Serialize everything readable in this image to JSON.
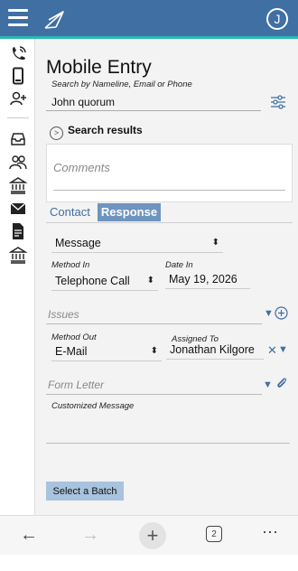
{
  "header": {
    "avatar_initial": "J"
  },
  "form": {
    "title": "Mobile Entry",
    "search_label": "Search by Nameline, Email or Phone",
    "search_value": "John quorum",
    "results_label": "Search results",
    "comments_placeholder": "Comments",
    "tabs": [
      {
        "label": "Contact"
      },
      {
        "label": "Response",
        "active": true
      }
    ],
    "message_type": "Message",
    "method_in_label": "Method In",
    "method_in_value": "Telephone Call",
    "date_in_label": "Date In",
    "date_in_value": "May 19, 2026",
    "issues_placeholder": "Issues",
    "method_out_label": "Method Out",
    "method_out_value": "E-Mail",
    "assigned_to_label": "Assigned To",
    "assigned_to_value": "Jonathan Kilgore",
    "form_letter_placeholder": "Form Letter",
    "customized_message_label": "Customized Message",
    "select_batch_label": "Select a Batch"
  },
  "browser": {
    "tab_count": "2"
  },
  "colors": {
    "brand_blue": "#3f6fa3",
    "accent_teal": "#2cb6b0",
    "active_tab": "#6e94c0"
  }
}
